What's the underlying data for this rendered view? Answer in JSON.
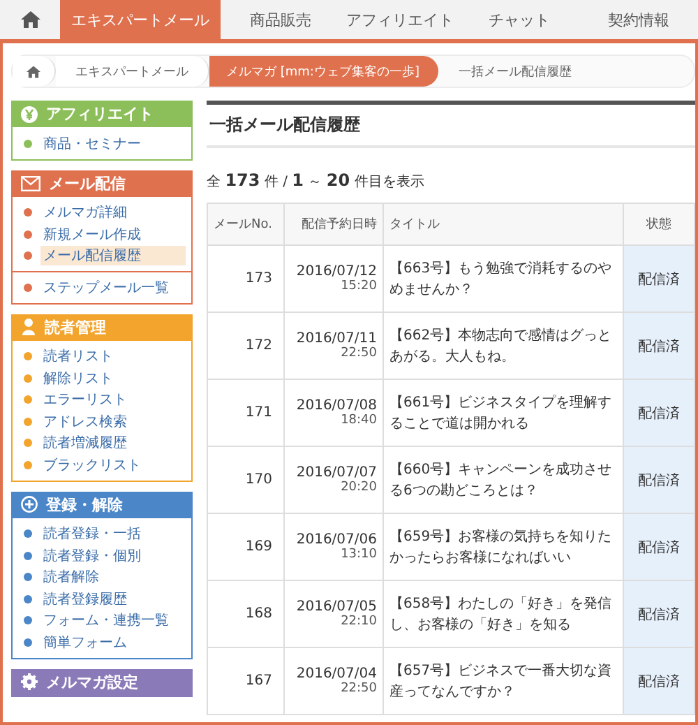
{
  "nav": {
    "tabs": [
      {
        "label": "エキスパートメール",
        "selected": true
      },
      {
        "label": "商品販売",
        "selected": false
      },
      {
        "label": "アフィリエイト",
        "selected": false
      },
      {
        "label": "チャット",
        "selected": false
      },
      {
        "label": "契約情報",
        "selected": false
      }
    ]
  },
  "breadcrumb": [
    {
      "label": "エキスパートメール",
      "selected": false
    },
    {
      "label": "メルマガ [mm:ウェブ集客の一歩]",
      "selected": true
    },
    {
      "label": "一括メール配信履歴",
      "selected": false
    }
  ],
  "sidebar": [
    {
      "title": "アフィリエイト",
      "color": "#8cbf5a",
      "groups": [
        [
          {
            "label": "商品・セミナー",
            "selected": false
          }
        ]
      ]
    },
    {
      "title": "メール配信",
      "color": "#e0714e",
      "groups": [
        [
          {
            "label": "メルマガ詳細",
            "selected": false
          },
          {
            "label": "新規メール作成",
            "selected": false
          },
          {
            "label": "メール配信履歴",
            "selected": true
          }
        ],
        [
          {
            "label": "ステップメール一覧",
            "selected": false
          }
        ]
      ]
    },
    {
      "title": "読者管理",
      "color": "#f2a42c",
      "groups": [
        [
          {
            "label": "読者リスト",
            "selected": false
          },
          {
            "label": "解除リスト",
            "selected": false
          },
          {
            "label": "エラーリスト",
            "selected": false
          },
          {
            "label": "アドレス検索",
            "selected": false
          },
          {
            "label": "読者増減履歴",
            "selected": false
          },
          {
            "label": "ブラックリスト",
            "selected": false
          }
        ]
      ]
    },
    {
      "title": "登録・解除",
      "color": "#4a86c8",
      "groups": [
        [
          {
            "label": "読者登録・一括",
            "selected": false
          },
          {
            "label": "読者登録・個別",
            "selected": false
          },
          {
            "label": "読者解除",
            "selected": false
          },
          {
            "label": "読者登録履歴",
            "selected": false
          },
          {
            "label": "フォーム・連携一覧",
            "selected": false
          },
          {
            "label": "簡単フォーム",
            "selected": false
          }
        ]
      ]
    },
    {
      "title": "メルマガ設定",
      "color": "#8a7ab8"
    }
  ],
  "main": {
    "title": "一括メール配信履歴",
    "summary": "全 **173** 件 / **1** ～ **20** 件目を表示",
    "table": {
      "columns": [
        "メールNo.",
        "配信予約日時",
        "タイトル",
        "状態"
      ],
      "rows": [
        {
          "no": "173",
          "date": "2016/07/12",
          "time": "15:20",
          "title": "【663号】もう勉強で消耗するのやめませんか？",
          "status": "配信済"
        },
        {
          "no": "172",
          "date": "2016/07/11",
          "time": "22:50",
          "title": "【662号】本物志向で感情はグっとあがる。大人もね。",
          "status": "配信済"
        },
        {
          "no": "171",
          "date": "2016/07/08",
          "time": "18:40",
          "title": "【661号】ビジネスタイプを理解することで道は開かれる",
          "status": "配信済"
        },
        {
          "no": "170",
          "date": "2016/07/07",
          "time": "20:20",
          "title": "【660号】キャンペーンを成功させる6つの勘どころとは？",
          "status": "配信済"
        },
        {
          "no": "169",
          "date": "2016/07/06",
          "time": "13:10",
          "title": "【659号】お客様の気持ちを知りたかったらお客様になればいい",
          "status": "配信済"
        },
        {
          "no": "168",
          "date": "2016/07/05",
          "time": "22:10",
          "title": "【658号】わたしの「好き」を発信し、お客様の「好き」を知る",
          "status": "配信済"
        },
        {
          "no": "167",
          "date": "2016/07/04",
          "time": "22:50",
          "title": "【657号】ビジネスで一番大切な資産ってなんですか？",
          "status": "配信済"
        }
      ]
    }
  }
}
